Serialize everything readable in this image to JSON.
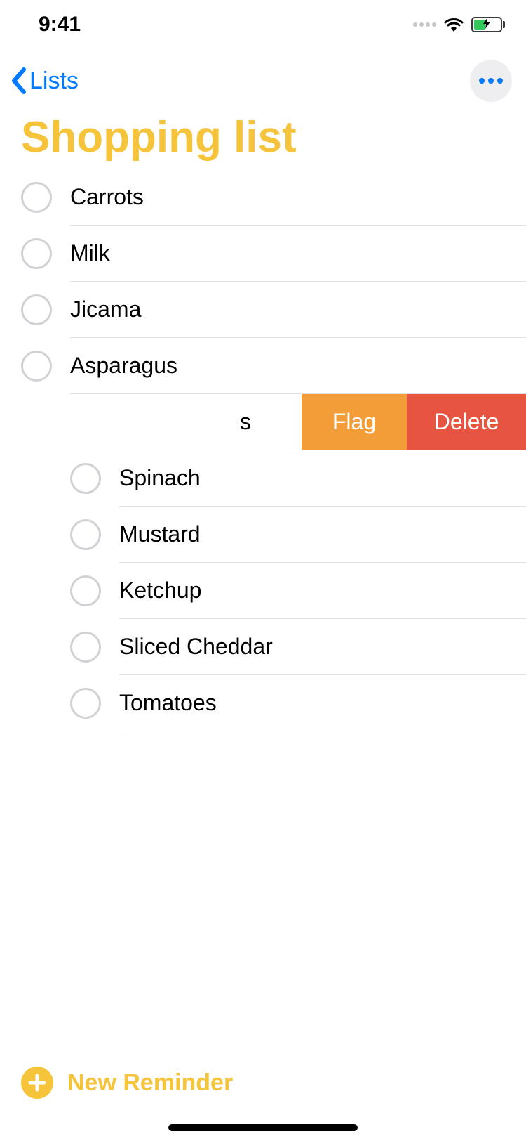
{
  "status": {
    "time": "9:41"
  },
  "nav": {
    "back_label": "Lists"
  },
  "title": "Shopping list",
  "reminders": [
    {
      "label": "Carrots"
    },
    {
      "label": "Milk"
    },
    {
      "label": "Jicama"
    },
    {
      "label": "Asparagus"
    }
  ],
  "swiped_row": {
    "visible_fragment": "s",
    "actions": {
      "flag": "Flag",
      "delete": "Delete"
    }
  },
  "indented_reminders": [
    {
      "label": "Spinach"
    },
    {
      "label": "Mustard"
    },
    {
      "label": "Ketchup"
    },
    {
      "label": "Sliced Cheddar"
    },
    {
      "label": "Tomatoes"
    }
  ],
  "footer": {
    "new_reminder_label": "New Reminder"
  },
  "colors": {
    "accent": "#f5c43b",
    "ios_blue": "#007aff",
    "flag": "#f29d38",
    "delete": "#e85442"
  }
}
